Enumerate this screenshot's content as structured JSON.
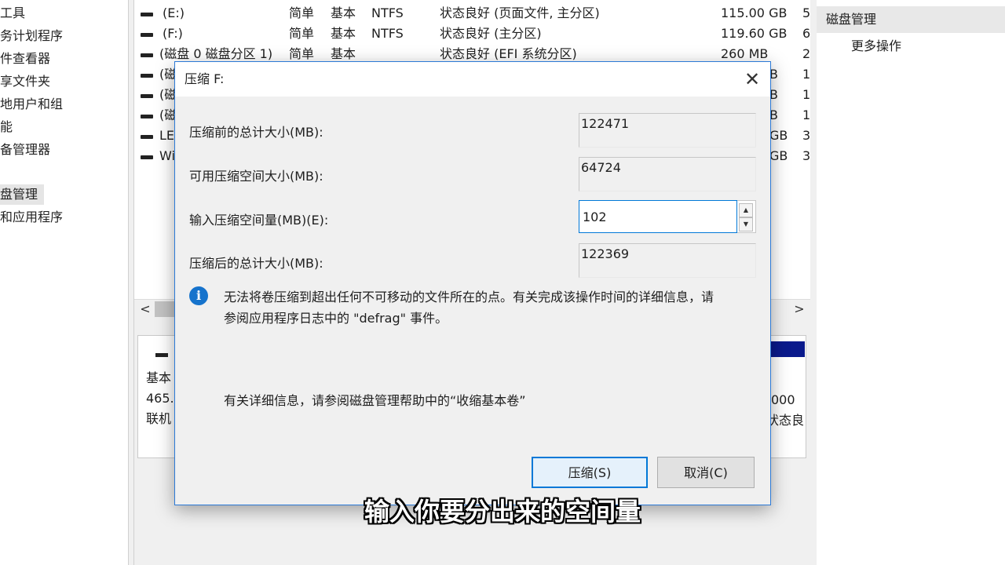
{
  "left_nav": {
    "items": [
      {
        "label": "工具"
      },
      {
        "label": "务计划程序"
      },
      {
        "label": "件查看器"
      },
      {
        "label": "享文件夹"
      },
      {
        "label": "地用户和组"
      },
      {
        "label": "能"
      },
      {
        "label": "备管理器"
      },
      {
        "label": "盘管理",
        "selected": true
      },
      {
        "label": "和应用程序"
      }
    ]
  },
  "volume_list": {
    "rows": [
      {
        "volume": "(E:)",
        "layout": "简单",
        "type": "基本",
        "fs": "NTFS",
        "status": "状态良好 (页面文件, 主分区)",
        "capacity": "115.00 GB",
        "tail": "5"
      },
      {
        "volume": "(F:)",
        "layout": "简单",
        "type": "基本",
        "fs": "NTFS",
        "status": "状态良好 (主分区)",
        "capacity": "119.60 GB",
        "tail": "6"
      },
      {
        "volume": "(磁盘 0 磁盘分区 1)",
        "layout": "简单",
        "type": "基本",
        "fs": "",
        "status": "状态良好 (EFI 系统分区)",
        "capacity": "260 MB",
        "tail": "2"
      },
      {
        "volume": "(磁",
        "layout": "",
        "type": "",
        "fs": "",
        "status": "",
        "capacity": "B",
        "tail": "1"
      },
      {
        "volume": "(磁",
        "layout": "",
        "type": "",
        "fs": "",
        "status": "",
        "capacity": "B",
        "tail": "1"
      },
      {
        "volume": "(磁",
        "layout": "",
        "type": "",
        "fs": "",
        "status": "",
        "capacity": "B",
        "tail": "1"
      },
      {
        "volume": "LE",
        "layout": "",
        "type": "",
        "fs": "",
        "status": "",
        "capacity": "GB",
        "tail": "3"
      },
      {
        "volume": "Wi",
        "layout": "",
        "type": "",
        "fs": "",
        "status": "",
        "capacity": "GB",
        "tail": "3"
      }
    ],
    "scroll_left": "<",
    "scroll_right": ">"
  },
  "disk_pane": {
    "line1": "基本",
    "line2": "465.",
    "line3": "联机",
    "right1": "000",
    "right2": "状态良"
  },
  "actions_pane": {
    "header": "磁盘管理",
    "more": "更多操作"
  },
  "dialog": {
    "title": "压缩 F:",
    "close_glyph": "✕",
    "total_before_label": "压缩前的总计大小(MB):",
    "total_before_value": "122471",
    "available_label": "可用压缩空间大小(MB):",
    "available_value": "64724",
    "amount_label": "输入压缩空间量(MB)(E):",
    "amount_value": "102",
    "total_after_label": "压缩后的总计大小(MB):",
    "total_after_value": "122369",
    "info_icon_glyph": "i",
    "info_text_line1": "无法将卷压缩到超出任何不可移动的文件所在的点。有关完成该操作时间的详细信息，请",
    "info_text_line2": "参阅应用程序日志中的 \"defrag\" 事件。",
    "detail_text": "有关详细信息，请参阅磁盘管理帮助中的“收缩基本卷”",
    "shrink_label": "压缩(S)",
    "cancel_label": "取消(C)"
  },
  "subtitle": "输入你要分出来的空间量"
}
